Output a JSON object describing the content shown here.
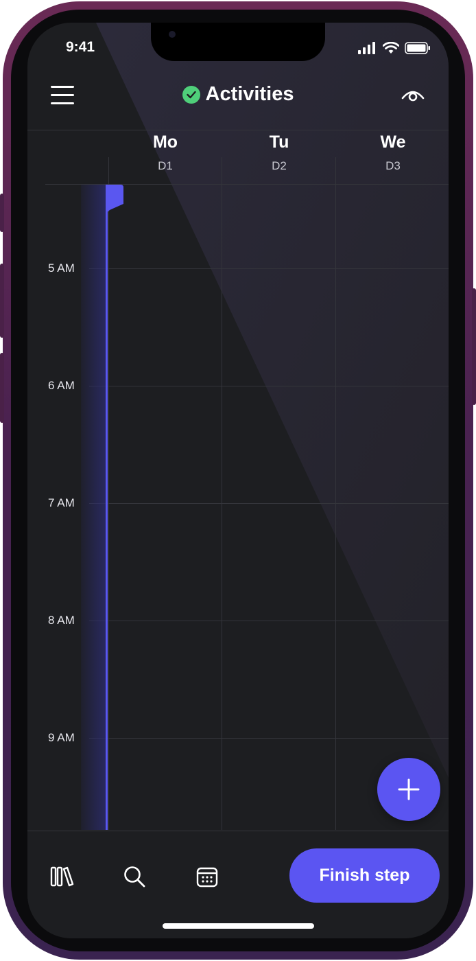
{
  "status_bar": {
    "time": "9:41"
  },
  "header": {
    "title": "Activities"
  },
  "days": [
    {
      "name": "Mo",
      "label": "D1"
    },
    {
      "name": "Tu",
      "label": "D2"
    },
    {
      "name": "We",
      "label": "D3"
    }
  ],
  "time_labels": [
    "5 AM",
    "6 AM",
    "7 AM",
    "8 AM",
    "9 AM"
  ],
  "bottom_bar": {
    "finish_label": "Finish step"
  },
  "colors": {
    "accent": "#5b55f2",
    "status_ok": "#4fcf7a",
    "background": "#1d1e21"
  },
  "icons": [
    "menu-icon",
    "check-circle-icon",
    "eye-icon",
    "plus-icon",
    "library-icon",
    "search-icon",
    "calendar-icon"
  ]
}
